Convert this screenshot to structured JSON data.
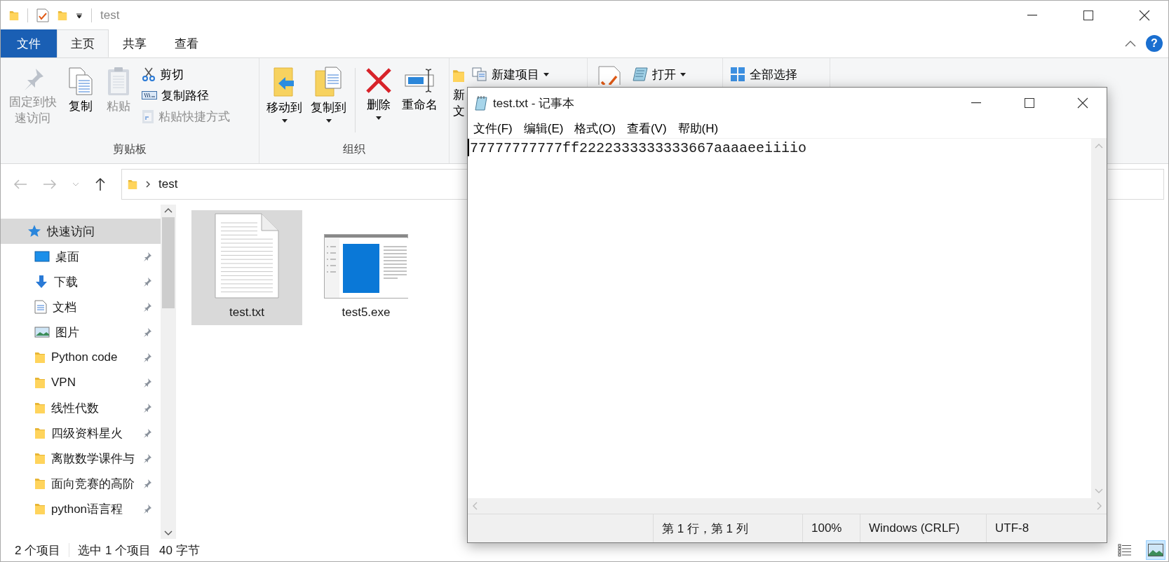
{
  "explorer": {
    "title": "test",
    "tabs": [
      {
        "label": "文件",
        "selected": false,
        "kind": "file"
      },
      {
        "label": "主页",
        "selected": true,
        "kind": "tab"
      },
      {
        "label": "共享",
        "selected": false,
        "kind": "tab"
      },
      {
        "label": "查看",
        "selected": false,
        "kind": "tab"
      }
    ],
    "help": "?",
    "ribbon": {
      "groups": [
        {
          "label": "剪贴板",
          "items": [
            {
              "kind": "large",
              "label": "固定到快速访问",
              "disabled": true
            },
            {
              "kind": "large",
              "label": "复制",
              "disabled": false
            },
            {
              "kind": "large",
              "label": "粘贴",
              "disabled": true
            },
            {
              "kind": "small",
              "label": "剪切",
              "disabled": false
            },
            {
              "kind": "small",
              "label": "复制路径",
              "disabled": false
            },
            {
              "kind": "small",
              "label": "粘贴快捷方式",
              "disabled": true
            }
          ]
        },
        {
          "label": "组织",
          "items": [
            {
              "kind": "large",
              "label": "移动到",
              "dropdown": true
            },
            {
              "kind": "large",
              "label": "复制到",
              "dropdown": true
            },
            {
              "kind": "large",
              "label": "删除",
              "dropdown": true
            },
            {
              "kind": "large",
              "label": "重命名",
              "dropdown": false
            }
          ]
        },
        {
          "items": [
            {
              "kind": "large",
              "lines": [
                "新",
                "文"
              ]
            },
            {
              "kind": "small",
              "label": "新建项目",
              "dropdown": true
            }
          ]
        },
        {
          "items": [
            {
              "kind": "large"
            },
            {
              "kind": "small",
              "label": "打开",
              "dropdown": true
            }
          ]
        },
        {
          "items": [
            {
              "kind": "small",
              "label": "全部选择"
            }
          ]
        }
      ]
    },
    "address": {
      "path": "test"
    },
    "sidebar": {
      "items": [
        {
          "label": "快速访问",
          "selected": true,
          "children": [
            {
              "label": "桌面",
              "pinned": true,
              "selected": false
            },
            {
              "label": "下载",
              "pinned": true,
              "selected": false
            },
            {
              "label": "文档",
              "pinned": true,
              "selected": false
            },
            {
              "label": "图片",
              "pinned": true,
              "selected": false
            },
            {
              "label": "Python code",
              "pinned": true,
              "selected": false
            },
            {
              "label": "VPN",
              "pinned": true,
              "selected": false
            },
            {
              "label": "线性代数",
              "pinned": true,
              "selected": false
            },
            {
              "label": "四级资料星火",
              "pinned": true,
              "selected": false
            },
            {
              "label": "离散数学课件与",
              "pinned": true,
              "selected": false
            },
            {
              "label": "面向竞赛的高阶",
              "pinned": true,
              "selected": false
            },
            {
              "label": "python语言程",
              "pinned": true,
              "selected": false
            }
          ]
        }
      ]
    },
    "files": [
      {
        "name": "test.txt",
        "selected": true
      },
      {
        "name": "test5.exe",
        "selected": false
      }
    ],
    "status_bar": {
      "count": "2 个项目",
      "selection": "选中 1 个项目",
      "size": "40 字节"
    },
    "view_buttons": [
      {
        "selected": false
      },
      {
        "selected": true
      }
    ]
  },
  "notepad": {
    "title": "test.txt - 记事本",
    "menu": [
      "文件(F)",
      "编辑(E)",
      "格式(O)",
      "查看(V)",
      "帮助(H)"
    ],
    "text": "77777777777ff2222333333333667aaaaeeiiiio",
    "status_bar": [
      "第 1 行，第 1 列",
      "100%",
      "Windows (CRLF)",
      "UTF-8"
    ]
  }
}
